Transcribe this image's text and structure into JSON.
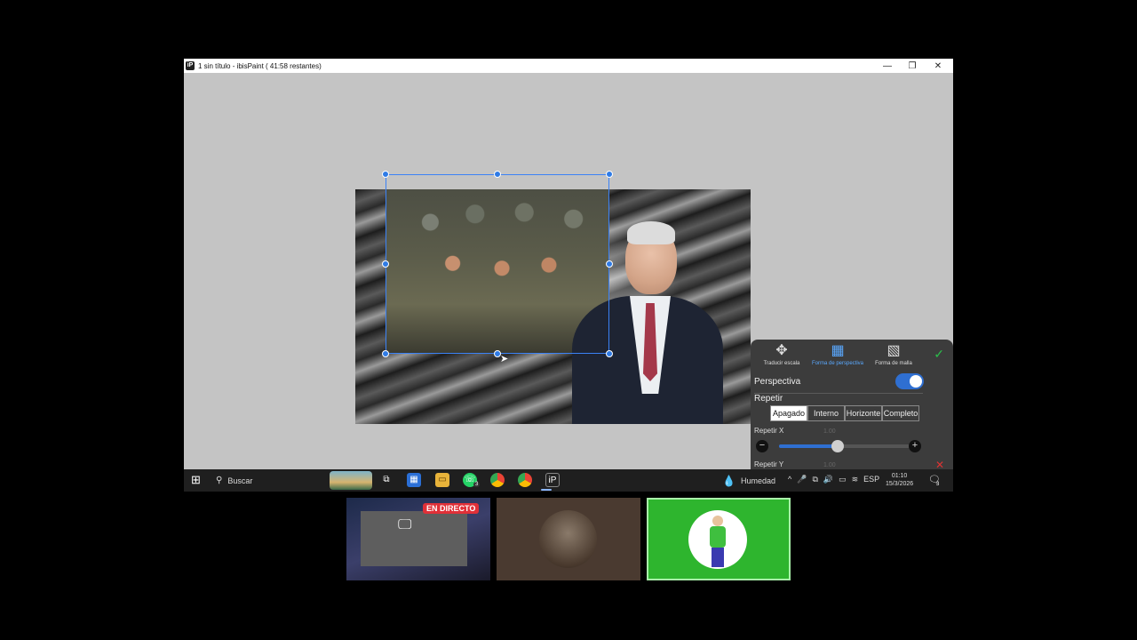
{
  "window": {
    "title": "1 sin título - ibisPaint ( 41:58 restantes)",
    "app_icon": "iP",
    "minimize": "—",
    "maximize": "❐",
    "close": "✕"
  },
  "panel": {
    "tabs": [
      {
        "label": "Traducir escala",
        "icon": "move-icon"
      },
      {
        "label": "Forma de perspectiva",
        "icon": "perspective-grid-icon"
      },
      {
        "label": "Forma de malla",
        "icon": "mesh-icon"
      }
    ],
    "tab_glyphs": [
      "✥",
      "▦",
      "▧"
    ],
    "confirm": "✓",
    "perspective_label": "Perspectiva",
    "perspective_on": true,
    "repeat_label": "Repetir",
    "repeat_options": [
      "Apagado",
      "Interno",
      "Horizonte",
      "Completo"
    ],
    "repeat_selected": "Apagado",
    "repeat_x_label": "Repetir X",
    "repeat_x_value": "1.00",
    "repeat_x_level": 0.44,
    "repeat_y_label": "Repetir Y",
    "repeat_y_value": "1.00",
    "minus": "−",
    "plus": "+",
    "cancel": "✕"
  },
  "taskbar": {
    "start_glyph": "⊞",
    "search_placeholder": "Buscar",
    "search_glyph": "⚲",
    "weather_label": "Humedad",
    "weather_glyph": "💧",
    "language": "ESP",
    "time": "01:10",
    "date": "15/3/2026",
    "whatsapp_badge": "3",
    "notification_badge": "3",
    "tray_glyphs": [
      "^",
      "🎤",
      "⧉",
      "🔊",
      "▭",
      "≋"
    ]
  },
  "meeting": {
    "live_label": "EN DIRECTO"
  },
  "colors": {
    "accent": "#2f7be6",
    "toggle_on": "#2f6fd1",
    "confirm": "#2bbf4b",
    "cancel": "#d33333",
    "live_badge": "#e03038",
    "speaker_tile": "#2eb52e"
  }
}
